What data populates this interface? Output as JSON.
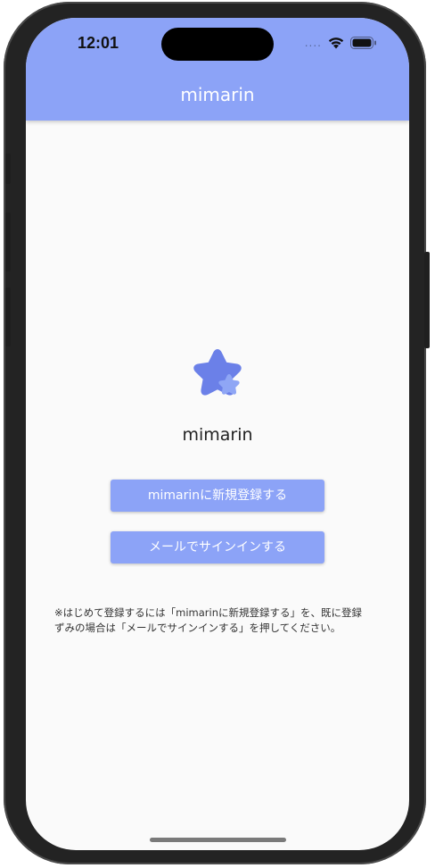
{
  "status_bar": {
    "time": "12:01",
    "signal": "....",
    "icons": [
      "wifi-icon",
      "battery-icon"
    ]
  },
  "app_bar": {
    "title": "mimarin"
  },
  "main": {
    "logo_icon": "star-logo-icon",
    "app_name": "mimarin",
    "register_button": "mimarinに新規登録する",
    "signin_button": "メールでサインインする",
    "note": "※はじめて登録するには「mimarinに新規登録する」を、既に登録ずみの場合は「メールでサインインする」を押してください。"
  },
  "colors": {
    "accent": "#8ca3f7",
    "logo_star": "#6b80e8",
    "logo_small_star": "#8fa6f5",
    "background": "#fafafa"
  }
}
